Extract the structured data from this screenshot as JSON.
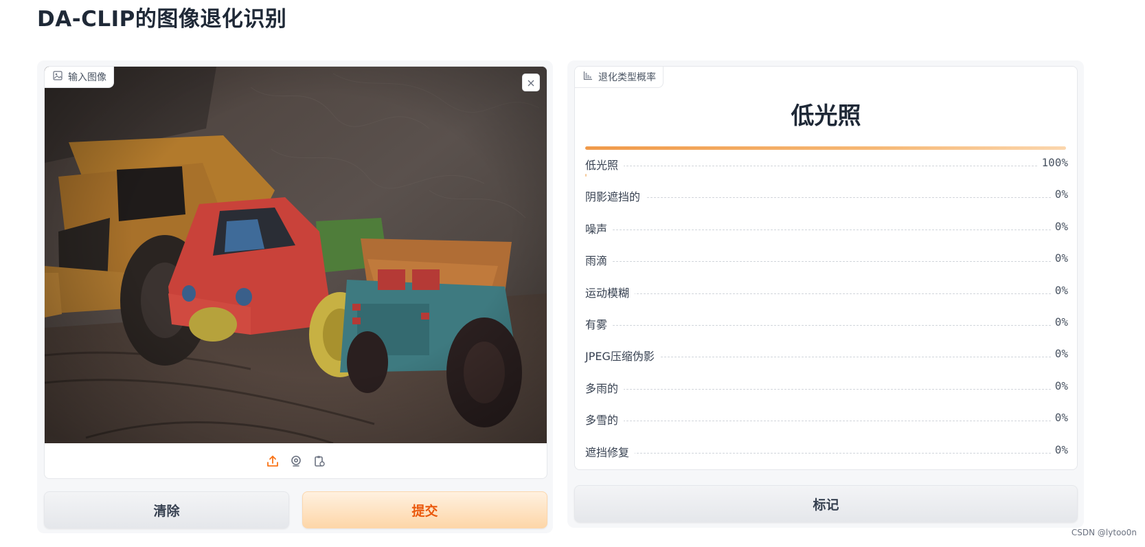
{
  "page": {
    "title": "DA-CLIP的图像退化识别"
  },
  "input_panel": {
    "label": "输入图像",
    "label_icon": "image-icon",
    "clear_icon": "close-icon",
    "sources": [
      "upload-icon",
      "webcam-icon",
      "clipboard-icon"
    ],
    "buttons": {
      "clear": "清除",
      "submit": "提交"
    }
  },
  "output_panel": {
    "label": "退化类型概率",
    "label_icon": "bar-chart-icon",
    "top_label": "低光照",
    "confidences": [
      {
        "label": "低光照",
        "value": "100%",
        "fraction": 1.0
      },
      {
        "label": "阴影遮挡的",
        "value": "0%",
        "fraction": 0.0
      },
      {
        "label": "噪声",
        "value": "0%",
        "fraction": 0.0
      },
      {
        "label": "雨滴",
        "value": "0%",
        "fraction": 0.0
      },
      {
        "label": "运动模糊",
        "value": "0%",
        "fraction": 0.0
      },
      {
        "label": "有雾",
        "value": "0%",
        "fraction": 0.0
      },
      {
        "label": "JPEG压缩伪影",
        "value": "0%",
        "fraction": 0.0
      },
      {
        "label": "多雨的",
        "value": "0%",
        "fraction": 0.0
      },
      {
        "label": "多雪的",
        "value": "0%",
        "fraction": 0.0
      },
      {
        "label": "遮挡修复",
        "value": "0%",
        "fraction": 0.0
      }
    ],
    "flag_button": "标记"
  },
  "watermark": "CSDN @lytoo0n",
  "colors": {
    "accent": "#ea580c",
    "bar": "#f09a4a"
  }
}
